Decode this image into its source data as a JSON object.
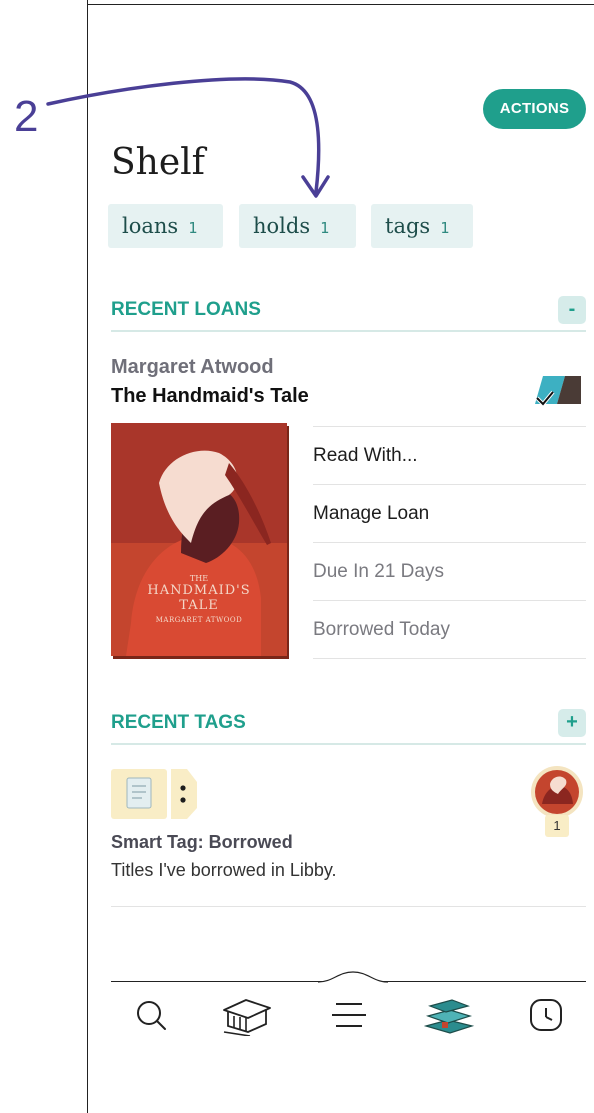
{
  "annotation": {
    "number": "2"
  },
  "header": {
    "actions_label": "ACTIONS",
    "title": "Shelf"
  },
  "chips": [
    {
      "label": "loans",
      "count": "1"
    },
    {
      "label": "holds",
      "count": "1"
    },
    {
      "label": "tags",
      "count": "1"
    }
  ],
  "recent_loans": {
    "heading": "RECENT LOANS",
    "collapse_symbol": "-",
    "item": {
      "author": "Margaret Atwood",
      "title": "The Handmaid's Tale",
      "cover": {
        "line1": "THE",
        "line2": "HANDMAID'S",
        "line3": "TALE",
        "author": "MARGARET ATWOOD"
      },
      "actions": [
        "Read With...",
        "Manage Loan",
        "Due In 21 Days",
        "Borrowed Today"
      ]
    }
  },
  "recent_tags": {
    "heading": "RECENT TAGS",
    "add_symbol": "+",
    "item": {
      "name": "Smart Tag: Borrowed",
      "description": "Titles I've borrowed in Libby.",
      "count": "1"
    }
  },
  "nav": {
    "icons": [
      "search-icon",
      "library-icon",
      "menu-icon",
      "shelf-icon",
      "timeline-icon"
    ]
  },
  "colors": {
    "accent": "#1f9f8c",
    "annotation": "#4a3f96",
    "chip_bg": "#e6f2f2"
  }
}
